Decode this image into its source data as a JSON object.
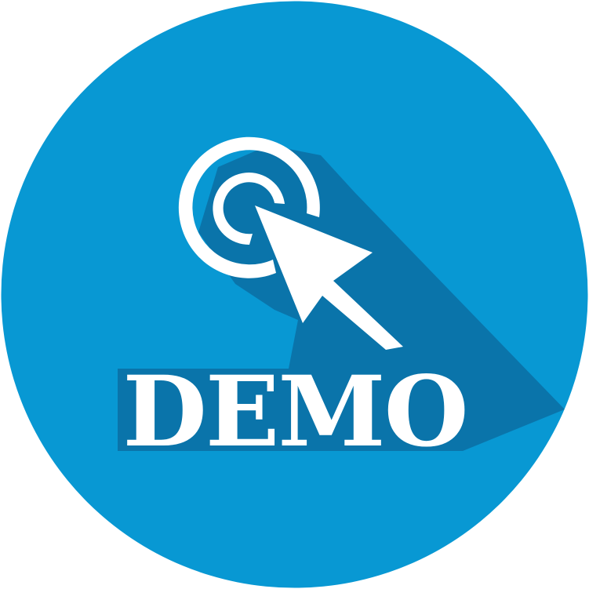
{
  "badge": {
    "label": "DEMO",
    "icon": "click-pointer-icon",
    "colors": {
      "circle": "#0898d3",
      "shadow": "#0a74aa",
      "foreground": "#ffffff"
    }
  }
}
